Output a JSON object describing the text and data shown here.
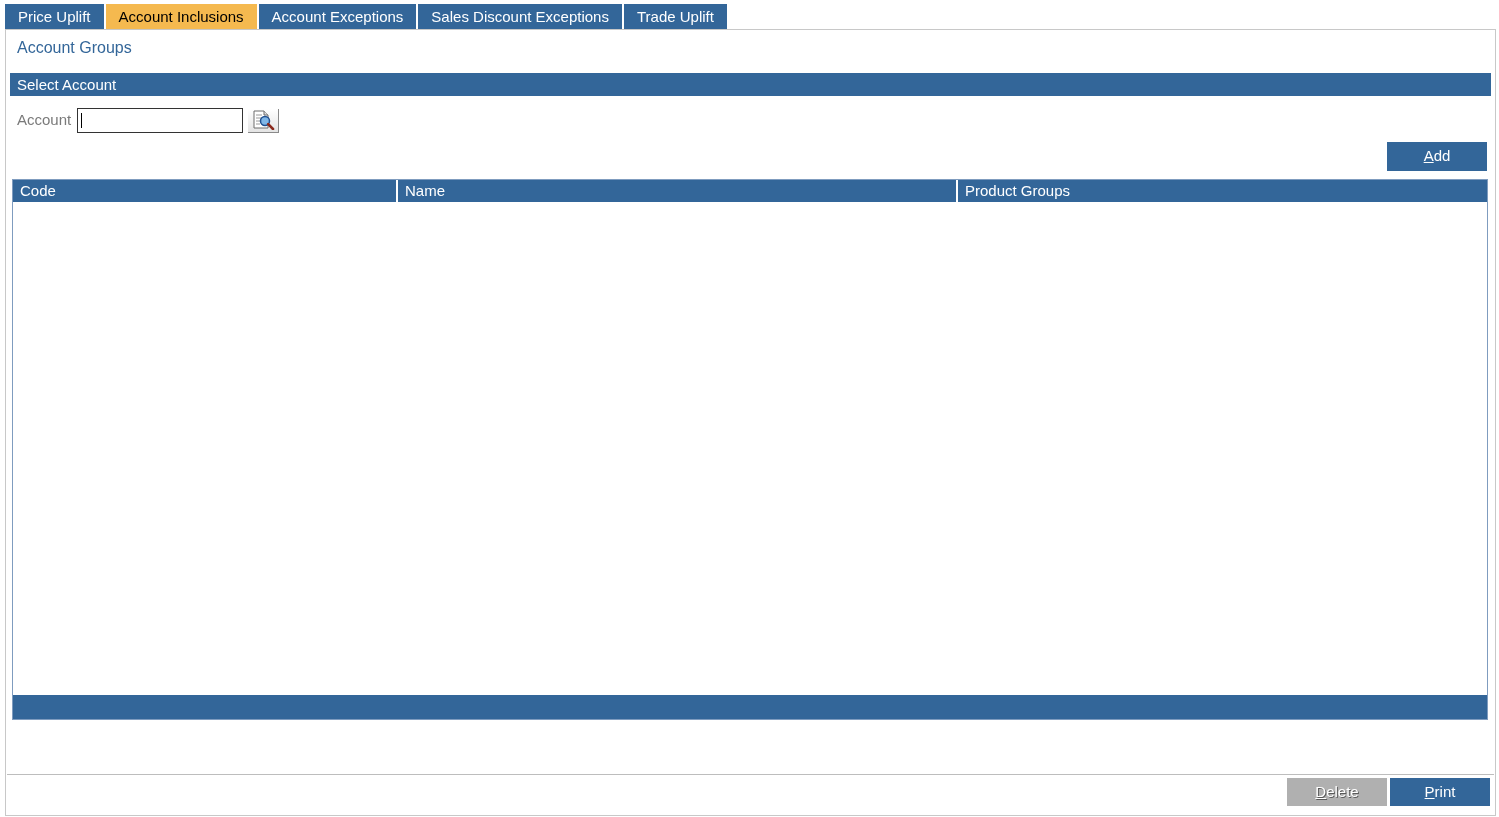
{
  "tabs": [
    {
      "label": "Price Uplift",
      "selected": false
    },
    {
      "label": "Account Inclusions",
      "selected": true
    },
    {
      "label": "Account Exceptions",
      "selected": false
    },
    {
      "label": "Sales Discount Exceptions",
      "selected": false
    },
    {
      "label": "Trade Uplift",
      "selected": false
    }
  ],
  "heading": "Account Groups",
  "select_account": {
    "title": "Select Account",
    "account_field": {
      "label": "Account",
      "focused": true
    }
  },
  "add_button": {
    "label": "Add",
    "disabled": false
  },
  "table": {
    "columns": [
      "Code",
      "Name",
      "Product Groups"
    ]
  },
  "footer_buttons": [
    {
      "label": "Delete",
      "disabled": true
    },
    {
      "label": "Print",
      "disabled": false
    }
  ]
}
